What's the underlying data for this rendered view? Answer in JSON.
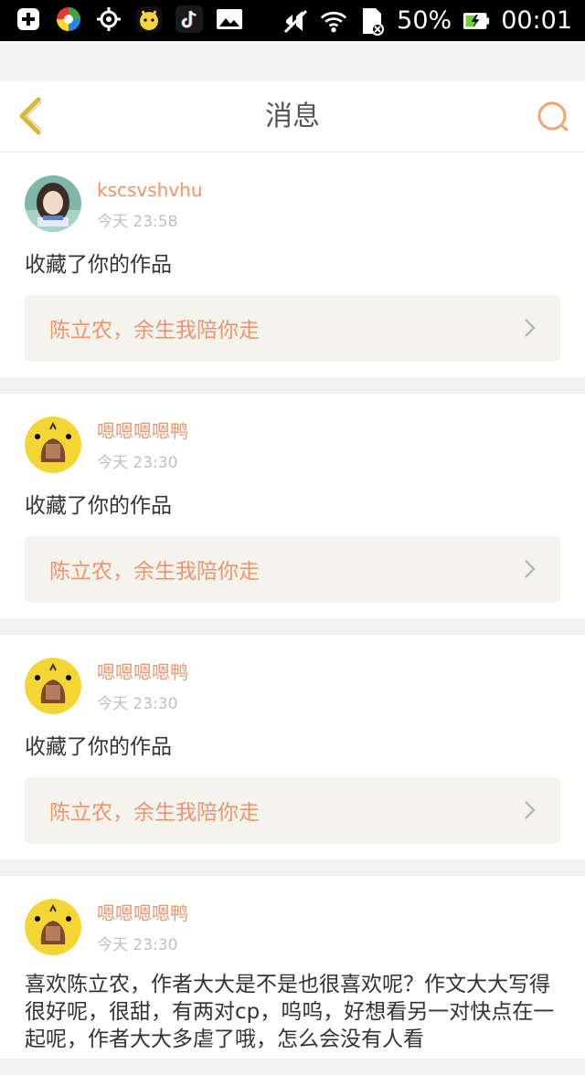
{
  "status_bar": {
    "battery_percent": "50%",
    "time": "00:01",
    "icons": [
      "plus-square-icon",
      "color-wheel-icon",
      "crosshair-icon",
      "pikachu-app-icon",
      "tiktok-icon",
      "image-icon",
      "mute-icon",
      "wifi-icon",
      "sim-card-icon",
      "battery-charging-icon"
    ]
  },
  "header": {
    "title": "消息",
    "back_icon": "chevron-left-icon",
    "search_icon": "search-icon"
  },
  "notifications": [
    {
      "username": "kscsvshvhu",
      "time": "今天 23:58",
      "action": "收藏了你的作品",
      "work_title": "陈立农，余生我陪你走"
    },
    {
      "username": "嗯嗯嗯嗯鸭",
      "time": "今天 23:30",
      "action": "收藏了你的作品",
      "work_title": "陈立农，余生我陪你走"
    },
    {
      "username": "嗯嗯嗯嗯鸭",
      "time": "今天 23:30",
      "action": "收藏了你的作品",
      "work_title": "陈立农，余生我陪你走"
    },
    {
      "username": "嗯嗯嗯嗯鸭",
      "time": "今天 23:30",
      "comment": "喜欢陈立农，作者大大是不是也很喜欢呢？作文大大写得很好呢，很甜，有两对cp，呜呜，好想看另一对快点在一起呢，作者大大多虐了哦，怎么会没有人看"
    }
  ],
  "colors": {
    "accent": "#f0946a",
    "back_icon": "#d9b53a",
    "work_bg": "#f4f3ee"
  }
}
